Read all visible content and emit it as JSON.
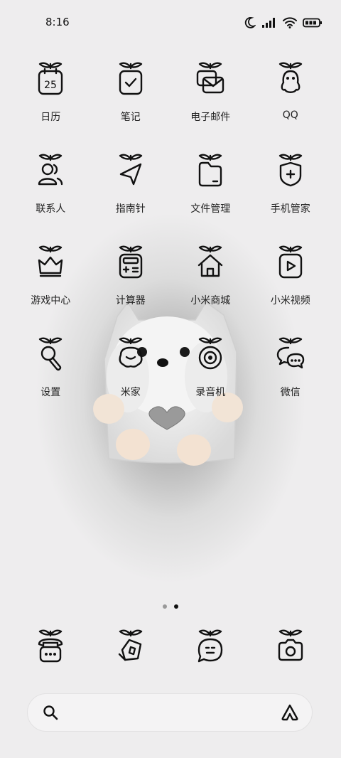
{
  "status_bar": {
    "time": "8:16",
    "icons": [
      "moon-icon",
      "signal-icon",
      "wifi-icon",
      "battery-icon"
    ]
  },
  "apps": {
    "row1": [
      {
        "label": "日历",
        "icon": "calendar-icon",
        "date": "25"
      },
      {
        "label": "笔记",
        "icon": "notes-icon"
      },
      {
        "label": "电子邮件",
        "icon": "email-icon"
      },
      {
        "label": "QQ",
        "icon": "qq-icon"
      }
    ],
    "row2": [
      {
        "label": "联系人",
        "icon": "contacts-icon"
      },
      {
        "label": "指南针",
        "icon": "compass-icon"
      },
      {
        "label": "文件管理",
        "icon": "file-manager-icon"
      },
      {
        "label": "手机管家",
        "icon": "security-icon"
      }
    ],
    "row3": [
      {
        "label": "游戏中心",
        "icon": "game-center-icon"
      },
      {
        "label": "计算器",
        "icon": "calculator-icon"
      },
      {
        "label": "小米商城",
        "icon": "mi-store-icon"
      },
      {
        "label": "小米视频",
        "icon": "mi-video-icon"
      }
    ],
    "row4": [
      {
        "label": "设置",
        "icon": "settings-icon"
      },
      {
        "label": "米家",
        "icon": "mi-home-icon"
      },
      {
        "label": "录音机",
        "icon": "recorder-icon"
      },
      {
        "label": "微信",
        "icon": "wechat-icon"
      }
    ]
  },
  "dock": [
    {
      "icon": "phone-icon"
    },
    {
      "icon": "browser-icon"
    },
    {
      "icon": "messages-icon"
    },
    {
      "icon": "camera-icon"
    }
  ],
  "page_indicator": {
    "count": 2,
    "active": 2
  },
  "search": {
    "placeholder": ""
  },
  "colors": {
    "icon_stroke": "#111111",
    "leaf": "#111111",
    "label": "#222222"
  }
}
